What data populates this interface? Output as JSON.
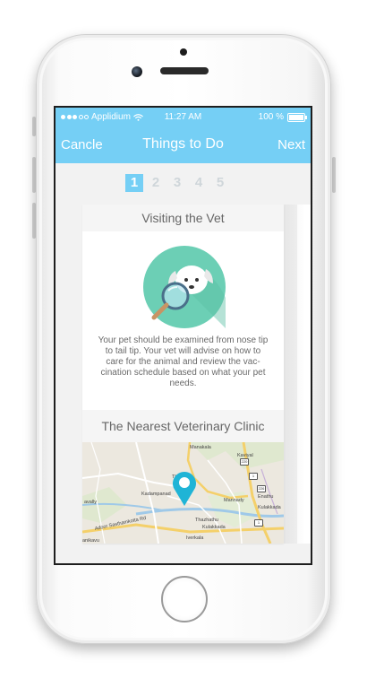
{
  "status_bar": {
    "carrier": "Applidium",
    "time": "11:27 AM",
    "battery": "100 %"
  },
  "nav": {
    "left_label": "Cancle",
    "title": "Things to Do",
    "right_label": "Next"
  },
  "steps": [
    {
      "label": "1",
      "active": true
    },
    {
      "label": "2",
      "active": false
    },
    {
      "label": "3",
      "active": false
    },
    {
      "label": "4",
      "active": false
    },
    {
      "label": "5",
      "active": false
    }
  ],
  "card": {
    "title": "Visiting the Vet",
    "icon": "puppy-magnifier-icon",
    "description": "Your pet should be examined from nose tip to tail tip. Your vet will advise on how to care for the animal and review the vac-cination schedule based on what your pet needs.",
    "clinic_title": "The Nearest Veterinary Clinic"
  },
  "map": {
    "labels": {
      "manakala": "Manakala",
      "kaviyal": "Kaviyal",
      "thoyoor": "Th    yoor",
      "kadampanad": "Kadampanad",
      "mannady": "Mannady",
      "enathu": "Enathu",
      "kulakkada": "Kulakkada",
      "thazhathu": "Thazhathu",
      "kulakkada2": "Kulakkada",
      "iverkala": "Iverkala",
      "avalley": "avally",
      "adoor_road": "Adoor Sasthamkotta Rd",
      "anikavu": "anikavu",
      "route_220": "220",
      "route_1": "1",
      "route_226": "226"
    }
  },
  "colors": {
    "accent": "#75cff5",
    "icon_circle": "#6ccfb5",
    "pin": "#1fb4d6"
  }
}
